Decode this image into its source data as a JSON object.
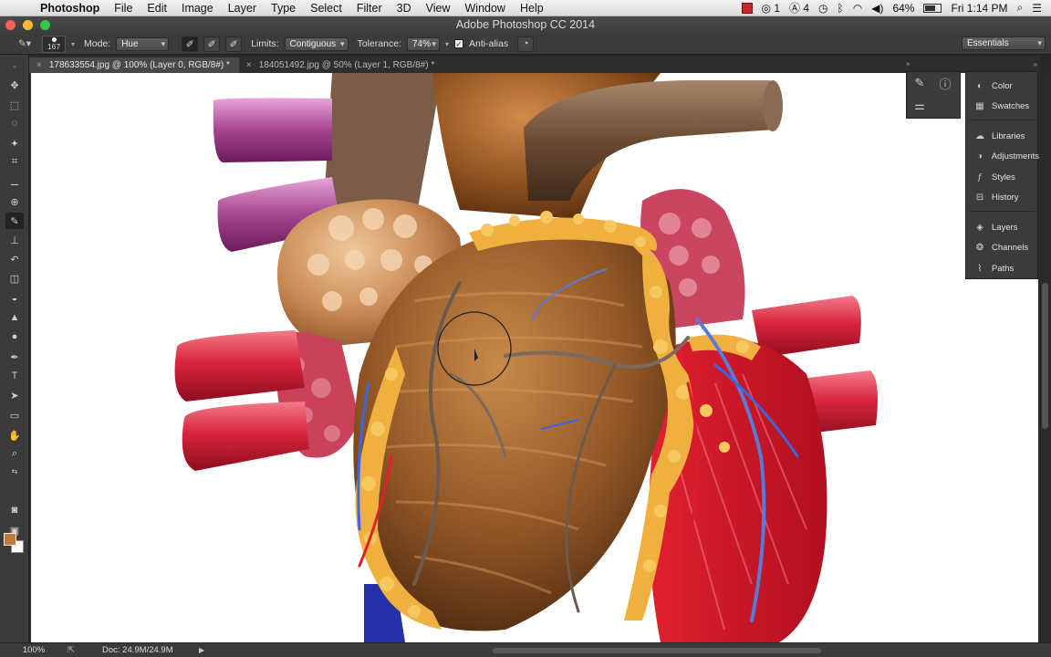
{
  "menubar": {
    "apple_icon": "apple-logo",
    "items": [
      "Photoshop",
      "File",
      "Edit",
      "Image",
      "Layer",
      "Type",
      "Select",
      "Filter",
      "3D",
      "View",
      "Window",
      "Help"
    ],
    "status": {
      "cc_count": "1",
      "adobe_count": "4",
      "battery": "64%",
      "clock": "Fri 1:14 PM"
    }
  },
  "window": {
    "title": "Adobe Photoshop CC 2014"
  },
  "options": {
    "brush_size": "167",
    "mode_label": "Mode:",
    "mode_value": "Hue",
    "limits_label": "Limits:",
    "limits_value": "Contiguous",
    "tolerance_label": "Tolerance:",
    "tolerance_value": "74%",
    "antialias_label": "Anti-alias",
    "workspace": "Essentials"
  },
  "tabs": [
    {
      "label": "178633554.jpg @ 100% (Layer 0, RGB/8#) *"
    },
    {
      "label": "184051492.jpg @ 50% (Layer 1, RGB/8#) *"
    }
  ],
  "panels": {
    "group1": [
      "Color",
      "Swatches"
    ],
    "group2": [
      "Libraries",
      "Adjustments",
      "Styles",
      "History"
    ],
    "group3": [
      "Layers",
      "Channels",
      "Paths"
    ]
  },
  "status": {
    "zoom": "100%",
    "doc": "Doc: 24.9M/24.9M"
  },
  "colors": {
    "foreground": "#c07a3a",
    "background": "#ffffff"
  }
}
